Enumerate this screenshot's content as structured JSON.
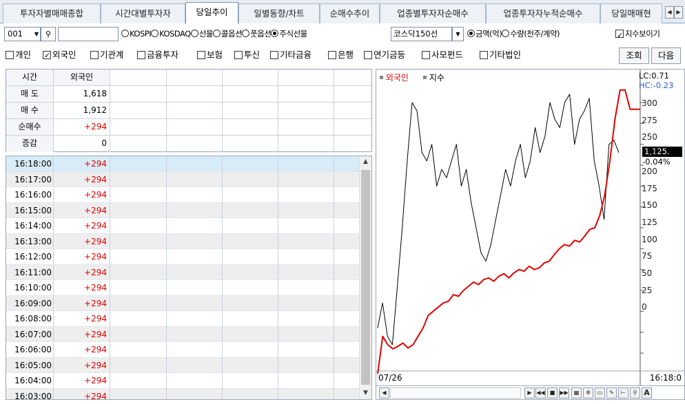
{
  "tabs": [
    {
      "label": "투자자별매매종합",
      "active": false
    },
    {
      "label": "시간대별투자자",
      "active": false
    },
    {
      "label": "당일추이",
      "active": true
    },
    {
      "label": "일별동향/차트",
      "active": false
    },
    {
      "label": "순매수추이",
      "active": false
    },
    {
      "label": "업종별투자자순매수",
      "active": false
    },
    {
      "label": "업종투자자누적순매수",
      "active": false
    },
    {
      "label": "당일매매현",
      "active": false
    }
  ],
  "toolbar1": {
    "code": "001",
    "search_value": "",
    "radios": [
      {
        "label": "KOSPI",
        "checked": false
      },
      {
        "label": "KOSDAQ",
        "checked": false
      },
      {
        "label": "선물",
        "checked": false
      },
      {
        "label": "콜옵션",
        "checked": false
      },
      {
        "label": "풋옵션",
        "checked": false
      },
      {
        "label": "주식선물",
        "checked": true
      }
    ],
    "futures_select": "코스닥150선",
    "unit_radios": [
      {
        "label": "금액(억)",
        "checked": true
      },
      {
        "label": "수량(천주/계약)",
        "checked": false
      }
    ],
    "show_index_label": "지수보이기",
    "show_index_checked": true
  },
  "investors": [
    {
      "label": "개인",
      "checked": false
    },
    {
      "label": "외국인",
      "checked": true
    },
    {
      "label": "기관계",
      "checked": false
    },
    {
      "label": "금융투자",
      "checked": false
    },
    {
      "label": "보험",
      "checked": false
    },
    {
      "label": "투신",
      "checked": false
    },
    {
      "label": "기타금융",
      "checked": false
    },
    {
      "label": "은행",
      "checked": false
    },
    {
      "label": "연기금등",
      "checked": false
    },
    {
      "label": "사모펀드",
      "checked": false
    },
    {
      "label": "기타법인",
      "checked": false
    }
  ],
  "buttons": {
    "query": "조회",
    "next": "다음"
  },
  "summary": {
    "header": {
      "label": "시간",
      "value": "외국인"
    },
    "rows": [
      {
        "label": "매 도",
        "value": "1,618",
        "red": false
      },
      {
        "label": "매 수",
        "value": "1,912",
        "red": false
      },
      {
        "label": "순매수",
        "value": "+294",
        "red": true
      },
      {
        "label": "증감",
        "value": "0",
        "red": false
      }
    ]
  },
  "time_rows": [
    {
      "time": "16:18:00",
      "value": "+294"
    },
    {
      "time": "16:17:00",
      "value": "+294"
    },
    {
      "time": "16:16:00",
      "value": "+294"
    },
    {
      "time": "16:15:00",
      "value": "+294"
    },
    {
      "time": "16:14:00",
      "value": "+294"
    },
    {
      "time": "16:13:00",
      "value": "+294"
    },
    {
      "time": "16:12:00",
      "value": "+294"
    },
    {
      "time": "16:11:00",
      "value": "+294"
    },
    {
      "time": "16:10:00",
      "value": "+294"
    },
    {
      "time": "16:09:00",
      "value": "+294"
    },
    {
      "time": "16:08:00",
      "value": "+294"
    },
    {
      "time": "16:07:00",
      "value": "+294"
    },
    {
      "time": "16:06:00",
      "value": "+294"
    },
    {
      "time": "16:05:00",
      "value": "+294"
    },
    {
      "time": "16:04:00",
      "value": "+294"
    },
    {
      "time": "16:03:00",
      "value": "+294"
    }
  ],
  "chart": {
    "legend": [
      {
        "label": "외국인",
        "color": "#e00000"
      },
      {
        "label": "지수",
        "color": "#000000"
      }
    ],
    "lc_label": "LC:0.71",
    "hc_label": "HC:-0.23",
    "current_value": "1,125.",
    "current_change": "-0.04%",
    "y_ticks": [
      "300",
      "275",
      "250",
      "225",
      "200",
      "175",
      "150",
      "125",
      "100",
      "75",
      "50",
      "25",
      "0"
    ],
    "x_start": "07/26",
    "x_end": "16:18:0",
    "foreign_color": "#e00000",
    "index_color": "#000000",
    "foreign_series": [
      -25,
      20,
      10,
      5,
      8,
      12,
      6,
      10,
      20,
      30,
      45,
      50,
      55,
      60,
      62,
      70,
      68,
      75,
      80,
      85,
      82,
      88,
      90,
      86,
      92,
      95,
      90,
      96,
      100,
      98,
      104,
      100,
      102,
      108,
      110,
      118,
      125,
      130,
      128,
      135,
      133,
      140,
      148,
      150,
      165,
      190,
      230,
      280,
      315,
      315,
      292,
      292,
      292
    ],
    "index_series": [
      30,
      60,
      20,
      10,
      80,
      150,
      230,
      300,
      290,
      240,
      230,
      250,
      200,
      220,
      210,
      230,
      250,
      200,
      220,
      180,
      150,
      120,
      110,
      130,
      160,
      190,
      220,
      200,
      230,
      250,
      210,
      230,
      270,
      240,
      260,
      300,
      280,
      270,
      300,
      310,
      250,
      280,
      290,
      305,
      230,
      200,
      160,
      250,
      255,
      240
    ]
  },
  "chart_controls": [
    "◀",
    "▶|",
    "◀◀",
    "■",
    "▶▶",
    "grid-icon",
    "gear-icon",
    "layout-icon",
    "crosshair-icon",
    "zoom-icon",
    "A"
  ]
}
